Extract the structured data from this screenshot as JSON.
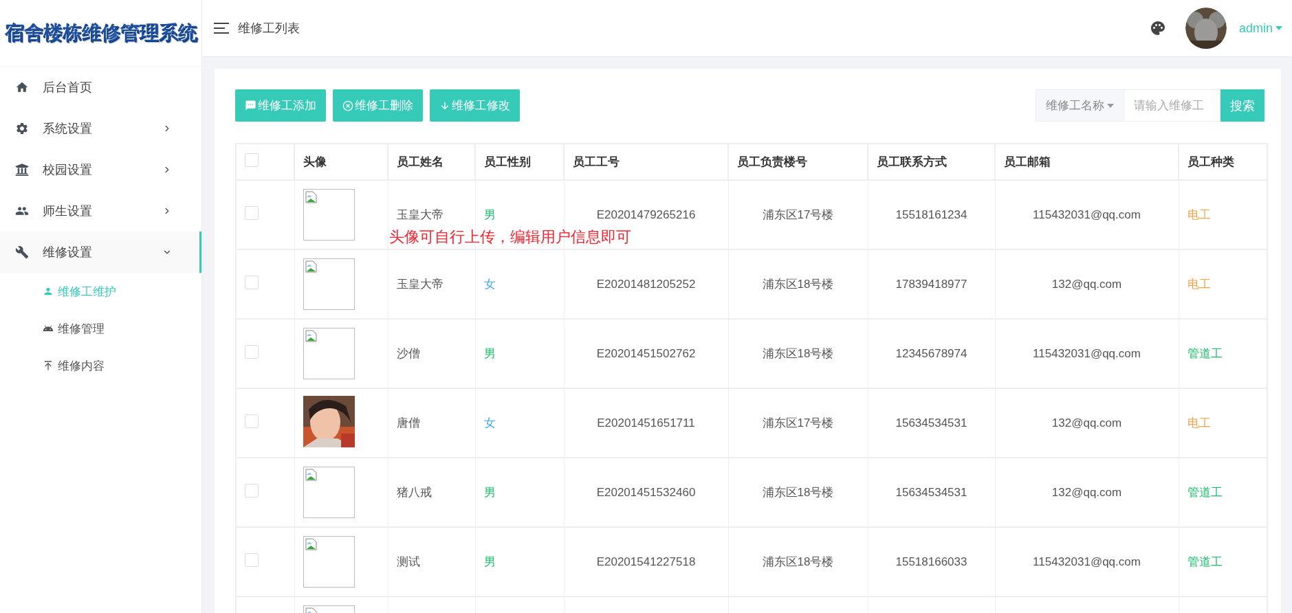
{
  "logo": {
    "text": "宿舍楼栋维修管理系统"
  },
  "sidebar": {
    "items": [
      {
        "label": "后台首页",
        "expanded": false
      },
      {
        "label": "系统设置",
        "expanded": false
      },
      {
        "label": "校园设置",
        "expanded": false
      },
      {
        "label": "师生设置",
        "expanded": false
      },
      {
        "label": "维修设置",
        "expanded": true,
        "children": [
          {
            "label": "维修工维护",
            "selected": true
          },
          {
            "label": "维修管理",
            "selected": false
          },
          {
            "label": "维修内容",
            "selected": false
          }
        ]
      }
    ]
  },
  "header": {
    "title": "维修工列表",
    "user": "admin"
  },
  "toolbar": {
    "buttons": [
      "维修工添加",
      "维修工删除",
      "维修工修改"
    ],
    "search": {
      "field": "维修工名称",
      "placeholder": "请输入维修工",
      "button": "搜索"
    }
  },
  "table": {
    "columns": [
      "头像",
      "员工姓名",
      "员工性别",
      "员工工号",
      "员工负责楼号",
      "员工联系方式",
      "员工邮箱",
      "员工种类"
    ],
    "select_all": {
      "checked": false
    },
    "note": "头像可自行上传，编辑用户信息即可",
    "rows": [
      {
        "checked": false,
        "avatar": {
          "kind": "broken"
        },
        "name": "玉皇大帝",
        "gender": {
          "text": "男",
          "color": "#19be6b"
        },
        "id": "E20201479265216",
        "building": "浦东区17号楼",
        "phone": "15518161234",
        "email": "115432031@qq.com",
        "type": {
          "text": "电工",
          "color": "#f7a042"
        }
      },
      {
        "checked": false,
        "avatar": {
          "kind": "broken"
        },
        "name": "玉皇大帝",
        "gender": {
          "text": "女",
          "color": "#3ea6f5"
        },
        "id": "E20201481205252",
        "building": "浦东区18号楼",
        "phone": "17839418977",
        "email": "132@qq.com",
        "type": {
          "text": "电工",
          "color": "#f7a042"
        }
      },
      {
        "checked": false,
        "avatar": {
          "kind": "broken"
        },
        "name": "沙僧",
        "gender": {
          "text": "男",
          "color": "#19be6b"
        },
        "id": "E20201451502762",
        "building": "浦东区18号楼",
        "phone": "12345678974",
        "email": "115432031@qq.com",
        "type": {
          "text": "管道工",
          "color": "#19be6b"
        }
      },
      {
        "checked": false,
        "name": "唐僧",
        "gender": {
          "text": "女",
          "color": "#3ea6f5"
        },
        "id": "E20201451651711",
        "building": "浦东区17号楼",
        "phone": "15634534531",
        "email": "132@qq.com",
        "type": {
          "text": "电工",
          "color": "#f7a042"
        }
      },
      {
        "checked": false,
        "avatar": {
          "kind": "broken"
        },
        "name": "猪八戒",
        "gender": {
          "text": "男",
          "color": "#19be6b"
        },
        "id": "E20201451532460",
        "building": "浦东区18号楼",
        "phone": "15634534531",
        "email": "132@qq.com",
        "type": {
          "text": "管道工",
          "color": "#19be6b"
        }
      },
      {
        "checked": false,
        "avatar": {
          "kind": "broken"
        },
        "name": "测试",
        "gender": {
          "text": "男",
          "color": "#19be6b"
        },
        "id": "E20201541227518",
        "building": "浦东区18号楼",
        "phone": "15518166033",
        "email": "115432031@qq.com",
        "type": {
          "text": "管道工",
          "color": "#19be6b"
        }
      },
      {
        "avatar": {
          "kind": "broken"
        }
      }
    ]
  }
}
